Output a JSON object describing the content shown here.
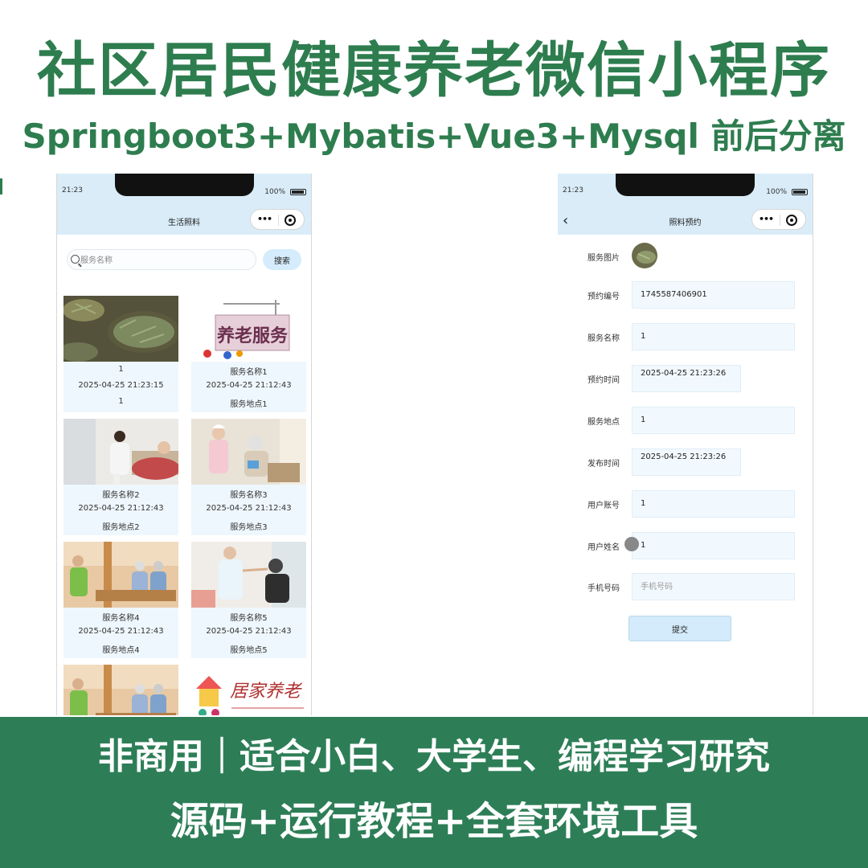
{
  "headline": "社区居民健康养老微信小程序",
  "subheadline": "Springboot3+Mybatis+Vue3+Mysql 前后分离",
  "phone_list": {
    "status_time": "21:23",
    "battery": "100%",
    "nav_title": "生活照料",
    "search_placeholder": "服务名称",
    "search_button": "搜索",
    "cards": [
      {
        "name": "1",
        "time": "2025-04-25 21:23:15",
        "place": "1",
        "image": "tea-leaves"
      },
      {
        "name": "服务名称1",
        "time": "2025-04-25 21:12:43",
        "place": "服务地点1",
        "image": "elderly-care-sign",
        "sign_text": "养老服务"
      },
      {
        "name": "服务名称2",
        "time": "2025-04-25 21:12:43",
        "place": "服务地点2",
        "image": "nurse-with-patient"
      },
      {
        "name": "服务名称3",
        "time": "2025-04-25 21:12:43",
        "place": "服务地点3",
        "image": "nurse-with-elder"
      },
      {
        "name": "服务名称4",
        "time": "2025-04-25 21:12:43",
        "place": "服务地点4",
        "image": "elders-in-lounge"
      },
      {
        "name": "服务名称5",
        "time": "2025-04-25 21:12:43",
        "place": "服务地点5",
        "image": "caregiver-feeding"
      },
      {
        "name": "",
        "time": "",
        "place": "",
        "image": "elders-in-lounge"
      },
      {
        "name": "",
        "time": "",
        "place": "",
        "image": "home-care-poster",
        "sign_text": "居家养老"
      }
    ]
  },
  "phone_form": {
    "status_time": "21:23",
    "battery": "100%",
    "nav_title": "照料预约",
    "back_icon": "‹",
    "fields": {
      "image_label": "服务图片",
      "booking_no_label": "预约编号",
      "booking_no": "1745587406901",
      "service_name_label": "服务名称",
      "service_name": "1",
      "booking_time_label": "预约时间",
      "booking_time": "2025-04-25 21:23:26",
      "place_label": "服务地点",
      "place": "1",
      "publish_time_label": "发布时间",
      "publish_time": "2025-04-25 21:23:26",
      "account_label": "用户账号",
      "account": "1",
      "username_label": "用户姓名",
      "username": "1",
      "phone_label": "手机号码",
      "phone_placeholder": "手机号码"
    },
    "submit": "提交"
  },
  "banner": {
    "line1": "非商用｜适合小白、大学生、编程学习研究",
    "line2": "源码+运行教程+全套环境工具"
  },
  "colors": {
    "brand_green": "#2e7d4f",
    "banner_green": "#2d7e57",
    "nav_blue": "#d9ecf8",
    "card_bg": "#eef7fd"
  }
}
